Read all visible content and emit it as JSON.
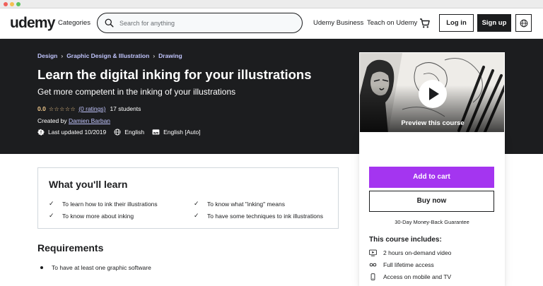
{
  "header": {
    "logo": "udemy",
    "categories": "Categories",
    "search_placeholder": "Search for anything",
    "business": "Udemy Business",
    "teach": "Teach on Udemy",
    "login": "Log in",
    "signup": "Sign up"
  },
  "breadcrumb": [
    "Design",
    "Graphic Design & Illustration",
    "Drawing"
  ],
  "course": {
    "title": "Learn the digital inking for your illustrations",
    "subtitle": "Get more competent in the inking of your illustrations",
    "rating": "0.0",
    "stars": "☆☆☆☆☆",
    "ratings_text": "(0 ratings)",
    "students": "17 students",
    "created_prefix": "Created by",
    "instructor": "Damien Barban",
    "last_updated": "Last updated 10/2019",
    "language": "English",
    "captions": "English [Auto]"
  },
  "sidebar": {
    "preview_label": "Preview this course",
    "add_to_cart": "Add to cart",
    "buy_now": "Buy now",
    "guarantee": "30-Day Money-Back Guarantee",
    "includes_title": "This course includes:",
    "includes": [
      "2 hours on-demand video",
      "Full lifetime access",
      "Access on mobile and TV"
    ]
  },
  "learn": {
    "title": "What you'll learn",
    "items": [
      "To learn how to ink their illustrations",
      "To know what \"inking\" means",
      "To know more about inking",
      "To have some techniques to ink illustrations"
    ]
  },
  "requirements": {
    "title": "Requirements",
    "items": [
      "To have at least one graphic software"
    ]
  },
  "colors": {
    "brand_purple": "#a435f0",
    "hero_bg": "#1c1d1f",
    "link_lavender": "#c0c4fc",
    "star_gold": "#f3ca8c"
  }
}
